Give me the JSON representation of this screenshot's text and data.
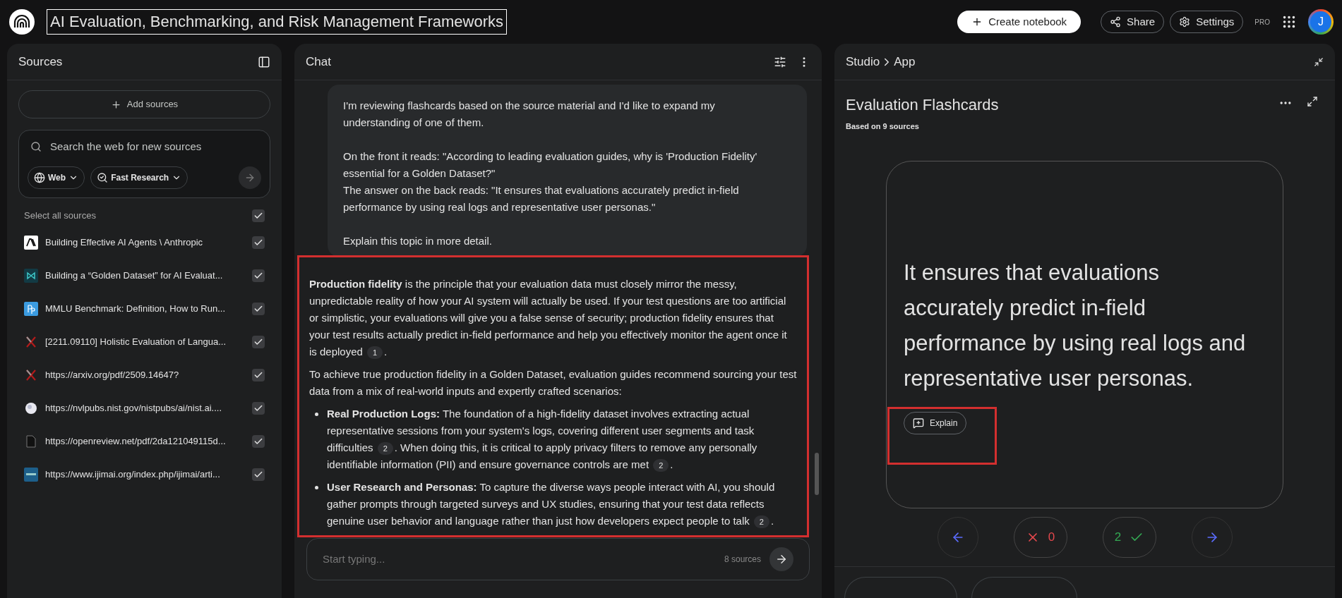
{
  "header": {
    "title": "AI Evaluation, Benchmarking, and Risk Management Frameworks",
    "create_button": "Create notebook",
    "share_button": "Share",
    "settings_button": "Settings",
    "plan_badge": "PRO",
    "avatar_initial": "J"
  },
  "sources": {
    "title": "Sources",
    "add_button": "Add sources",
    "search": {
      "placeholder": "Search the web for new sources"
    },
    "web_chip": "Web",
    "research_chip": "Fast Research",
    "select_all": {
      "label": "Select all sources",
      "checked": true
    },
    "items": [
      {
        "kind": "anthropic",
        "label": "Building Effective AI Agents \\ Anthropic",
        "checked": true
      },
      {
        "kind": "bowtie",
        "label": "Building a “Golden Dataset” for AI Evaluat...",
        "checked": true
      },
      {
        "kind": "pp",
        "label": "MMLU Benchmark: Definition, How to Run...",
        "checked": true
      },
      {
        "kind": "arxiv",
        "label": "[2211.09110] Holistic Evaluation of Langua...",
        "checked": true
      },
      {
        "kind": "arxiv",
        "label": "https://arxiv.org/pdf/2509.14647?",
        "checked": true
      },
      {
        "kind": "globe",
        "label": "https://nvlpubs.nist.gov/nistpubs/ai/nist.ai....",
        "checked": true
      },
      {
        "kind": "file",
        "label": "https://openreview.net/pdf/2da121049115d...",
        "checked": true
      },
      {
        "kind": "journal",
        "label": "https://www.ijimai.org/index.php/ijimai/arti...",
        "checked": true
      }
    ]
  },
  "chat": {
    "title": "Chat",
    "user_message": [
      "I'm reviewing flashcards based on the source material and I'd like to expand my understanding of one of them.",
      "On the front it reads: \"According to leading evaluation guides, why is 'Production Fidelity' essential for a Golden Dataset?\"\nThe answer on the back reads: \"It ensures that evaluations accurately predict in-field performance by using real logs and representative user personas.\"",
      "Explain this topic in more detail."
    ],
    "response": {
      "highlighted": true,
      "blocks": [
        {
          "kind": "paragraph",
          "segments": [
            {
              "kind": "bold",
              "text": "Production fidelity"
            },
            {
              "kind": "text",
              "text": " is the principle that your evaluation data must closely mirror the messy, unpredictable reality of how your AI system will actually be used. If your test questions are too artificial or simplistic, your evaluations will give you a false sense of security; production fidelity ensures that your test results actually predict in-field performance and help you effectively monitor the agent once it is deployed "
            },
            {
              "kind": "cite",
              "text": "1"
            },
            {
              "kind": "text",
              "text": "."
            }
          ]
        },
        {
          "kind": "paragraph",
          "segments": [
            {
              "kind": "text",
              "text": "To achieve true production fidelity in a Golden Dataset, evaluation guides recommend sourcing your test data from a mix of real-world inputs and expertly crafted scenarios:"
            }
          ]
        },
        {
          "kind": "bullet",
          "segments": [
            {
              "kind": "bold",
              "text": "Real Production Logs:"
            },
            {
              "kind": "text",
              "text": " The foundation of a high-fidelity dataset involves extracting actual representative sessions from your system's logs, covering different user segments and task difficulties "
            },
            {
              "kind": "cite",
              "text": "2"
            },
            {
              "kind": "text",
              "text": ". When doing this, it is critical to apply privacy filters to remove any personally identifiable information (PII) and ensure governance controls are met "
            },
            {
              "kind": "cite",
              "text": "2"
            },
            {
              "kind": "text",
              "text": "."
            }
          ]
        },
        {
          "kind": "bullet",
          "segments": [
            {
              "kind": "bold",
              "text": "User Research and Personas:"
            },
            {
              "kind": "text",
              "text": " To capture the diverse ways people interact with AI, you should gather prompts through targeted surveys and UX studies, ensuring that your test data reflects genuine user behavior and language rather than just how developers expect people to talk "
            },
            {
              "kind": "cite",
              "text": "2"
            },
            {
              "kind": "text",
              "text": "."
            }
          ]
        }
      ]
    },
    "input": {
      "placeholder": "Start typing...",
      "source_count": "8 sources"
    }
  },
  "studio": {
    "breadcrumb": [
      "Studio",
      "App"
    ],
    "title": "Evaluation Flashcards",
    "subtitle": "Based on 9 sources",
    "card": {
      "text": "It ensures that evaluations accurately predict in-field performance by using real logs and representative user personas.",
      "explain_button": "Explain",
      "explain_highlighted": true
    },
    "wrong_count": "0",
    "right_count": "2"
  }
}
